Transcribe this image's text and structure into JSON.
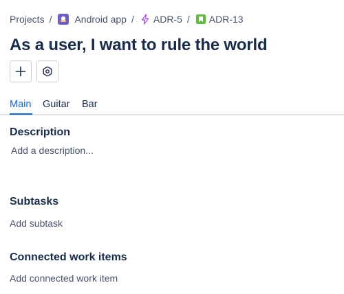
{
  "breadcrumb": {
    "items": [
      {
        "label": "Projects",
        "icon": null
      },
      {
        "label": "Android app",
        "icon": "project-avatar-icon"
      },
      {
        "label": "ADR-5",
        "icon": "epic-icon"
      },
      {
        "label": "ADR-13",
        "icon": "story-icon"
      }
    ],
    "separator": "/"
  },
  "issue": {
    "title": "As a user, I want to rule the world"
  },
  "actions": [
    {
      "icon": "plus-icon"
    },
    {
      "icon": "hexagon-settings-icon"
    }
  ],
  "tabs": [
    {
      "label": "Main",
      "active": true
    },
    {
      "label": "Guitar",
      "active": false
    },
    {
      "label": "Bar",
      "active": false
    }
  ],
  "description": {
    "heading": "Description",
    "placeholder": "Add a description..."
  },
  "subtasks": {
    "heading": "Subtasks",
    "action": "Add subtask"
  },
  "connected": {
    "heading": "Connected work items",
    "action": "Add connected work item"
  },
  "colors": {
    "accent": "#0c66e4",
    "text": "#172b4d",
    "subtle": "#44546f",
    "epic": "#a855f7",
    "story": "#63ba3c",
    "project": "#6e5dc6"
  }
}
